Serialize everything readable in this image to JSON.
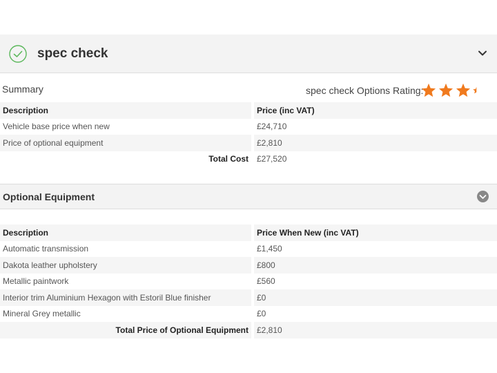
{
  "header": {
    "title": "spec check",
    "icons": {
      "check": "check-circle-icon",
      "toggle": "chevron-down-icon"
    },
    "colors": {
      "check": "#5cb85c",
      "accent_star": "#f07a1e"
    }
  },
  "summary": {
    "label": "Summary",
    "rating_label": "spec check Options Rating:",
    "rating_value": 3.5,
    "rating_max": 5,
    "table": {
      "headers": [
        "Description",
        "Price (inc VAT)"
      ],
      "rows": [
        [
          "Vehicle base price when new",
          "£24,710"
        ],
        [
          "Price of optional equipment",
          "£2,810"
        ]
      ],
      "total_label": "Total Cost",
      "total_value": "£27,520"
    }
  },
  "optional": {
    "title": "Optional Equipment",
    "table": {
      "headers": [
        "Description",
        "Price When New (inc VAT)"
      ],
      "rows": [
        [
          "Automatic transmission",
          "£1,450"
        ],
        [
          "Dakota leather upholstery",
          "£800"
        ],
        [
          "Metallic paintwork",
          "£560"
        ],
        [
          "Interior trim Aluminium Hexagon with Estoril Blue finisher",
          "£0"
        ],
        [
          "Mineral Grey metallic",
          "£0"
        ]
      ],
      "total_label": "Total Price of Optional Equipment",
      "total_value": "£2,810"
    }
  }
}
